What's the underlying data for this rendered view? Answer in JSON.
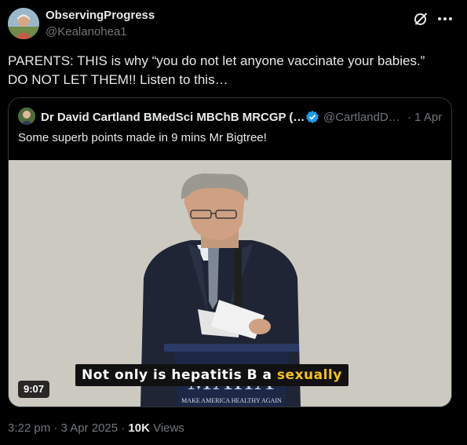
{
  "author": {
    "name": "ObservingProgress",
    "handle": "@Kealanohea1"
  },
  "tweet": {
    "line1": "PARENTS:  THIS is why “you do not let anyone vaccinate your babies.”",
    "line2": "DO NOT LET THEM!!  Listen to this…"
  },
  "quote": {
    "name": "Dr David Cartland BMedSci MBChB MRCGP (…",
    "handle": "@CartlandD…",
    "date": "· 1 Apr",
    "text": "Some superb points made in 9 mins Mr Bigtree!"
  },
  "video": {
    "caption_main": "Not only is hepatitis B a ",
    "caption_highlight": "sexually",
    "duration": "9:07",
    "podium_logo": "MAHA",
    "podium_tagline": "MAKE AMERICA HEALTHY AGAIN"
  },
  "footer": {
    "time": "3:22 pm · 3 Apr 2025 · ",
    "views_count": "10K",
    "views_label": " Views"
  },
  "colors": {
    "background": "#000000",
    "text_primary": "#e7e9ea",
    "text_secondary": "#71767b",
    "verified_blue": "#1d9bf0",
    "caption_highlight": "#f4c21b"
  },
  "icons": [
    "grok-icon",
    "more-icon",
    "verified-badge-icon"
  ]
}
